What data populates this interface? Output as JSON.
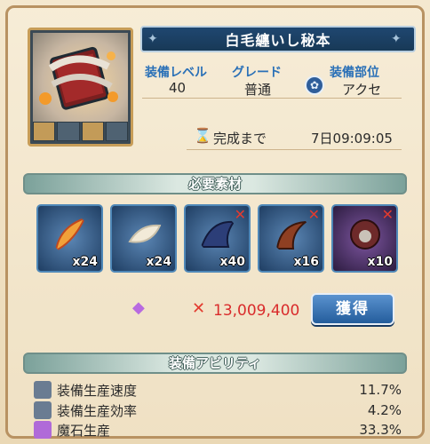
{
  "item": {
    "name": "白毛纏いし秘本",
    "level_label": "装備レベル",
    "level_value": "40",
    "grade_label": "グレード",
    "grade_value": "普通",
    "slot_label": "装備部位",
    "slot_value": "アクセ",
    "complete_label": "完成まで",
    "complete_time": "7日09:09:05"
  },
  "materials_title": "必要素材",
  "materials": [
    {
      "name": "feather",
      "qty": "x24",
      "missing": false
    },
    {
      "name": "white-fur",
      "qty": "x24",
      "missing": false
    },
    {
      "name": "dragon-wing",
      "qty": "x40",
      "missing": true
    },
    {
      "name": "dragon-tail",
      "qty": "x16",
      "missing": true
    },
    {
      "name": "demon-mane",
      "qty": "x10",
      "missing": true
    }
  ],
  "cost": {
    "value": "13,009,400",
    "x_mark": "✕"
  },
  "obtain_button": "獲得",
  "abilities_title": "装備アビリティ",
  "abilities": [
    {
      "name": "装備生産速度",
      "value": "11.7%"
    },
    {
      "name": "装備生産効率",
      "value": "4.2%"
    },
    {
      "name": "魔石生産",
      "value": "33.3%"
    }
  ],
  "colors": {
    "accent": "#2a70b7",
    "missing": "#e33b2f",
    "cost": "#d92b2b"
  }
}
